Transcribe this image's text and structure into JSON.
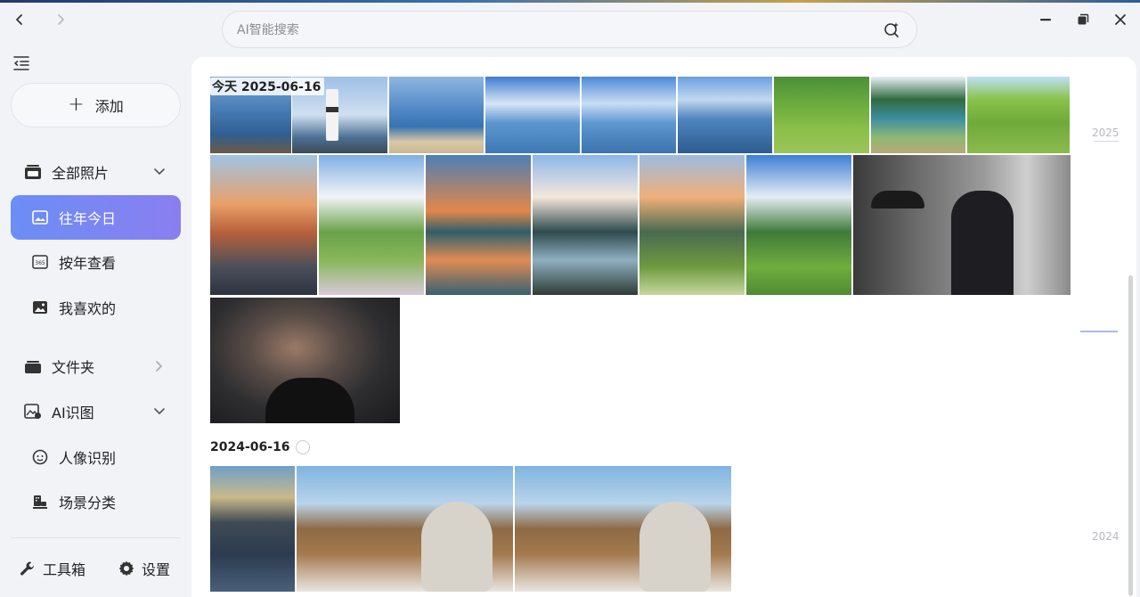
{
  "search": {
    "placeholder": "AI智能搜索"
  },
  "sidebar": {
    "add_label": "添加",
    "items": [
      {
        "label": "全部照片"
      },
      {
        "label": "往年今日"
      },
      {
        "label": "按年查看"
      },
      {
        "label": "我喜欢的"
      },
      {
        "label": "文件夹"
      },
      {
        "label": "AI识图"
      },
      {
        "label": "人像识别"
      },
      {
        "label": "场景分类"
      }
    ],
    "toolbox_label": "工具箱",
    "settings_label": "设置"
  },
  "main": {
    "groups": [
      {
        "date": "今天 2025-06-16"
      },
      {
        "date": "2024-06-16"
      }
    ],
    "year_markers": [
      "2025",
      "2024"
    ]
  },
  "colors": {
    "accent_start": "#6b8ef5",
    "accent_end": "#8a7ef0"
  }
}
